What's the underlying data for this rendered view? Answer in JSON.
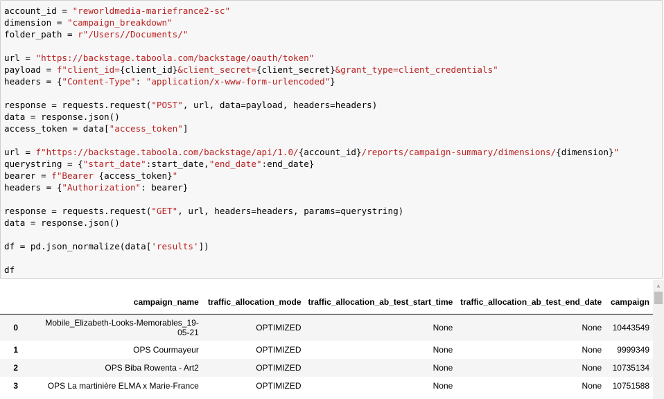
{
  "code_cell": {
    "line1": {
      "a": "account_id = ",
      "b": "\"reworldmedia-mariefrance2-sc\""
    },
    "line2": {
      "a": "dimension = ",
      "b": "\"campaign_breakdown\""
    },
    "line3": {
      "a": "folder_path = ",
      "b": "r\"/Users//Documents/\""
    },
    "line5": {
      "a": "url = ",
      "b": "\"https://backstage.taboola.com/backstage/oauth/token\""
    },
    "line6": {
      "a": "payload = ",
      "b": "f\"client_id=",
      "c": "{client_id}",
      "d": "&client_secret=",
      "e": "{client_secret}",
      "f": "&grant_type=client_credentials\""
    },
    "line7": {
      "a": "headers = {",
      "b": "\"Content-Type\"",
      "c": ": ",
      "d": "\"application/x-www-form-urlencoded\"",
      "e": "}"
    },
    "line9": {
      "a": "response = requests.request(",
      "b": "\"POST\"",
      "c": ", url, data=payload, headers=headers)"
    },
    "line10": {
      "a": "data = response.json()"
    },
    "line11": {
      "a": "access_token = data[",
      "b": "\"access_token\"",
      "c": "]"
    },
    "line13": {
      "a": "url = ",
      "b": "f\"https://backstage.taboola.com/backstage/api/1.0/",
      "c": "{account_id}",
      "d": "/reports/campaign-summary/dimensions/",
      "e": "{dimension}",
      "f": "\""
    },
    "line14": {
      "a": "querystring = {",
      "b": "\"start_date\"",
      "c": ":start_date,",
      "d": "\"end_date\"",
      "e": ":end_date}"
    },
    "line15": {
      "a": "bearer = ",
      "b": "f\"Bearer ",
      "c": "{access_token}",
      "d": "\""
    },
    "line16": {
      "a": "headers = {",
      "b": "\"Authorization\"",
      "c": ": bearer}"
    },
    "line18": {
      "a": "response = requests.request(",
      "b": "\"GET\"",
      "c": ", url, headers=headers, params=querystring)"
    },
    "line19": {
      "a": "data = response.json()"
    },
    "line21": {
      "a": "df = pd.json_normalize(data[",
      "b": "'results'",
      "c": "])"
    },
    "line23": {
      "a": "df"
    }
  },
  "output_table": {
    "columns": [
      "campaign_name",
      "traffic_allocation_mode",
      "traffic_allocation_ab_test_start_time",
      "traffic_allocation_ab_test_end_date",
      "campaign"
    ],
    "rows": [
      {
        "index": "0",
        "campaign_name": "Mobile_Elizabeth-Looks-Memorables_19-05-21",
        "traffic_allocation_mode": "OPTIMIZED",
        "start_time": "None",
        "end_date": "None",
        "campaign": "10443549"
      },
      {
        "index": "1",
        "campaign_name": "OPS Courmayeur",
        "traffic_allocation_mode": "OPTIMIZED",
        "start_time": "None",
        "end_date": "None",
        "campaign": "9999349"
      },
      {
        "index": "2",
        "campaign_name": "OPS Biba Rowenta - Art2",
        "traffic_allocation_mode": "OPTIMIZED",
        "start_time": "None",
        "end_date": "None",
        "campaign": "10735134"
      },
      {
        "index": "3",
        "campaign_name": "OPS La martinière ELMA x Marie-France",
        "traffic_allocation_mode": "OPTIMIZED",
        "start_time": "None",
        "end_date": "None",
        "campaign": "10751588"
      }
    ]
  },
  "icons": {
    "scroll_up": "chevron-up-icon"
  }
}
